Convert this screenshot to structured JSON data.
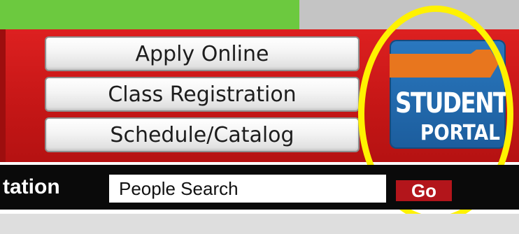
{
  "colors": {
    "green_bar": "#6cc93f",
    "top_strip": "#c4c4c4",
    "red_band": "#c41616",
    "portal_blue": "#1c5d9d",
    "portal_tab_orange": "#e8761e",
    "highlight_yellow": "#fff200",
    "black_bar": "#0a0a0a",
    "go_button": "#b3151b"
  },
  "nav": {
    "buttons": [
      {
        "label": "Apply Online"
      },
      {
        "label": "Class Registration"
      },
      {
        "label": "Schedule/Catalog"
      }
    ]
  },
  "portal": {
    "line1": "STUDENT",
    "line2": "PORTAL",
    "icon": "student-portal-logo"
  },
  "search_bar": {
    "left_label": "tation",
    "input_value": "People Search",
    "go_label": "Go"
  }
}
